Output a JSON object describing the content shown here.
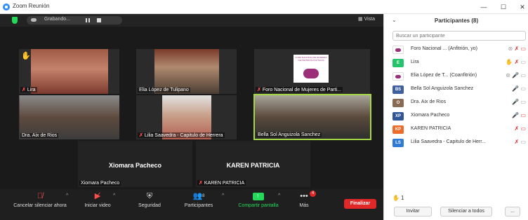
{
  "window": {
    "title": "Zoom Reunión",
    "minimize": "—",
    "maximize": "☐",
    "close": "✕"
  },
  "meeting": {
    "recording_label": "Grabando...",
    "view_label": "Vista",
    "tiles": [
      {
        "name": "Lira",
        "muted": true,
        "raised_hand": true,
        "color": "#9c4a35"
      },
      {
        "name": "Elia López de Tulipano",
        "muted": false,
        "color": "#6b5a48"
      },
      {
        "name": "Foro Nacional de Mujeres de Parti...",
        "muted": true,
        "logo_text": "FORO NACIONAL DE MUJERES DE PARTIDOS POLÍTICOS",
        "color": "#2a2a2a"
      },
      {
        "name": "Dra. Aix de Rios",
        "muted": false,
        "color": "#6e6e6e"
      },
      {
        "name": "Lilia Saavedra - Capitulo de Herrera",
        "muted": true,
        "color": "#cccccc"
      },
      {
        "name": "Bella Sol Anguizola Sanchez",
        "muted": false,
        "active": true,
        "color": "#555040"
      },
      {
        "name": "Xiomara Pacheco",
        "display": "Xiomara Pacheco",
        "muted": false
      },
      {
        "name": "KAREN PATRICIA",
        "display": "KAREN PATRICIA",
        "muted": true
      }
    ]
  },
  "toolbar": {
    "unmute": "Cancelar silenciar ahora",
    "video": "Iniciar video",
    "security": "Seguridad",
    "participants": "Participantes",
    "participants_count": "8",
    "share": "Compartir pantalla",
    "more": "Más",
    "more_badge": "4",
    "end": "Finalizar"
  },
  "panel": {
    "title": "Participantes (8)",
    "search_placeholder": "Buscar un participante",
    "participants": [
      {
        "name": "Foro Nacional ... (Anfitrión, yo)",
        "avatar": "",
        "avatar_color": "#ffffff",
        "logo": true,
        "icons": "⦿ 🎤 ▭"
      },
      {
        "name": "Lira",
        "avatar": "E",
        "avatar_color": "#23c46b",
        "icons": "✋ 🎤 ▭"
      },
      {
        "name": "Elia López de T... (Coanfitrión)",
        "avatar": "",
        "avatar_color": "#ffffff",
        "logo": true,
        "icons": "⦿ 🎤 ▭"
      },
      {
        "name": "Bella Sol Anguizola Sanchez",
        "avatar": "BS",
        "avatar_color": "#3d5fa0",
        "icons": "🎤 ▭"
      },
      {
        "name": "Dra. Aix de Rios",
        "avatar": "O",
        "avatar_color": "#8a6a52",
        "icons": "🎤 ▭"
      },
      {
        "name": "Xiomara Pacheco",
        "avatar": "XP",
        "avatar_color": "#2f5597",
        "icons": "🎤 ▭"
      },
      {
        "name": "KAREN PATRICIA",
        "avatar": "KP",
        "avatar_color": "#ef6b2a",
        "icons": "🎤 ▭"
      },
      {
        "name": "Lilia Saavedra - Capitulo de Herr...",
        "avatar": "LS",
        "avatar_color": "#2f7bd6",
        "icons": "🎤 ▭"
      }
    ],
    "raised_hands": "1",
    "invite": "Invitar",
    "mute_all": "Silenciar a todos",
    "more": "..."
  }
}
